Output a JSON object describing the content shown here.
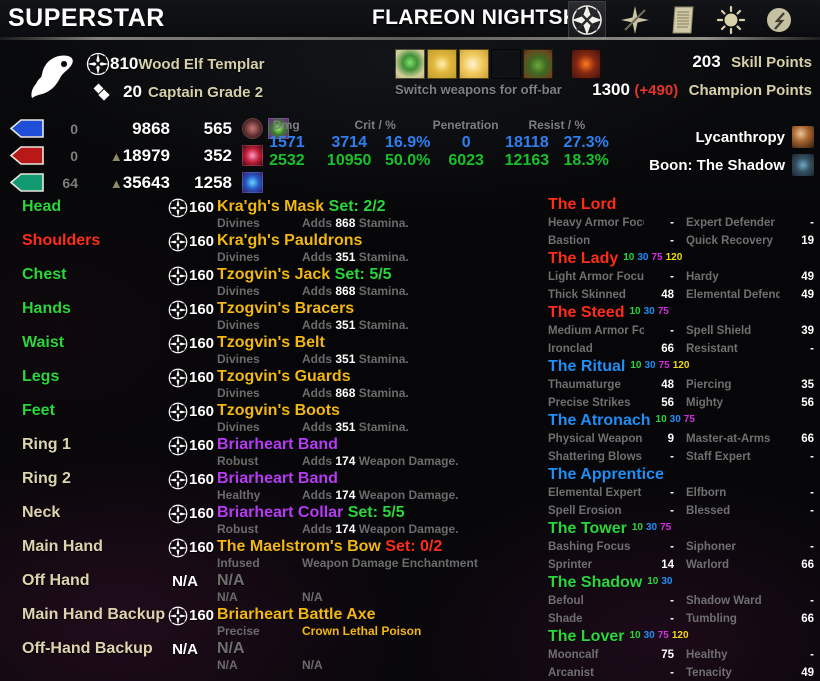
{
  "header": {
    "character_name": "SUPERSTAR",
    "account_name": "FLAREON NIGHTSKY",
    "nav_icons": [
      {
        "name": "inventory-icon",
        "selected": true
      },
      {
        "name": "skills-icon",
        "selected": false
      },
      {
        "name": "journal-icon",
        "selected": false
      },
      {
        "name": "map-icon",
        "selected": false
      },
      {
        "name": "alliance-war-icon",
        "selected": false
      }
    ]
  },
  "hero": {
    "champion_points_level": "810",
    "race_class": "Wood Elf Templar",
    "alliance_rank": "20",
    "alliance_rank_name": "Captain Grade 2",
    "switch_message": "Switch weapons for off-bar",
    "skill_points": "203",
    "skill_points_label": "Skill Points",
    "champion_points": "1300",
    "champion_points_bonus": "(+490)",
    "champion_points_label": "Champion Points"
  },
  "resources": [
    {
      "name": "magicka",
      "color": "#1f4fd8",
      "regen": "0",
      "max": "9868",
      "has_arrow": false,
      "recovery": "565"
    },
    {
      "name": "health",
      "color": "#b81818",
      "regen": "0",
      "max": "18979",
      "has_arrow": true,
      "recovery": "352"
    },
    {
      "name": "stamina",
      "color": "#129a72",
      "regen": "64",
      "max": "35643",
      "has_arrow": true,
      "recovery": "1258"
    }
  ],
  "damage_table": {
    "headers": [
      "Dmg",
      "Crit / %",
      "Penetration",
      "Resist / %"
    ],
    "magicka": {
      "dmg": "1571",
      "crit": "3714",
      "crit_pct": "16.9%",
      "pen": "0",
      "resist": "18118",
      "resist_pct": "27.3%"
    },
    "stamina": {
      "dmg": "2532",
      "crit": "10950",
      "crit_pct": "50.0%",
      "pen": "6023",
      "resist": "12163",
      "resist_pct": "18.3%"
    }
  },
  "statuses": [
    {
      "label": "Lycanthropy",
      "icon": "werewolf-icon"
    },
    {
      "label": "Boon: The Shadow",
      "icon": "mundus-stone-icon"
    }
  ],
  "equipment": [
    {
      "slot": "Head",
      "slot_color": "green",
      "level": "160",
      "item": "Kra'gh's Mask",
      "quality": "gold",
      "set": "Set: 2/2",
      "set_ok": true,
      "trait": "Divines",
      "ench_prefix": "Adds ",
      "ench_amount": "868",
      "ench_suffix": " Stamina."
    },
    {
      "slot": "Shoulders",
      "slot_color": "red",
      "level": "160",
      "item": "Kra'gh's Pauldrons",
      "quality": "gold",
      "set": "",
      "set_ok": true,
      "trait": "Divines",
      "ench_prefix": "Adds ",
      "ench_amount": "351",
      "ench_suffix": " Stamina."
    },
    {
      "slot": "Chest",
      "slot_color": "green",
      "level": "160",
      "item": "Tzogvin's Jack",
      "quality": "gold",
      "set": "Set: 5/5",
      "set_ok": true,
      "trait": "Divines",
      "ench_prefix": "Adds ",
      "ench_amount": "868",
      "ench_suffix": " Stamina."
    },
    {
      "slot": "Hands",
      "slot_color": "green",
      "level": "160",
      "item": "Tzogvin's Bracers",
      "quality": "gold",
      "set": "",
      "set_ok": true,
      "trait": "Divines",
      "ench_prefix": "Adds ",
      "ench_amount": "351",
      "ench_suffix": " Stamina."
    },
    {
      "slot": "Waist",
      "slot_color": "green",
      "level": "160",
      "item": "Tzogvin's Belt",
      "quality": "gold",
      "set": "",
      "set_ok": true,
      "trait": "Divines",
      "ench_prefix": "Adds ",
      "ench_amount": "351",
      "ench_suffix": " Stamina."
    },
    {
      "slot": "Legs",
      "slot_color": "green",
      "level": "160",
      "item": "Tzogvin's Guards",
      "quality": "gold",
      "set": "",
      "set_ok": true,
      "trait": "Divines",
      "ench_prefix": "Adds ",
      "ench_amount": "868",
      "ench_suffix": " Stamina."
    },
    {
      "slot": "Feet",
      "slot_color": "green",
      "level": "160",
      "item": "Tzogvin's Boots",
      "quality": "gold",
      "set": "",
      "set_ok": true,
      "trait": "Divines",
      "ench_prefix": "Adds ",
      "ench_amount": "351",
      "ench_suffix": " Stamina."
    },
    {
      "slot": "Ring 1",
      "slot_color": "tan",
      "level": "160",
      "item": "Briarheart Band",
      "quality": "purple",
      "set": "",
      "set_ok": true,
      "trait": "Robust",
      "ench_prefix": "Adds ",
      "ench_amount": "174",
      "ench_suffix": " Weapon Damage."
    },
    {
      "slot": "Ring 2",
      "slot_color": "tan",
      "level": "160",
      "item": "Briarheart Band",
      "quality": "purple",
      "set": "",
      "set_ok": true,
      "trait": "Healthy",
      "ench_prefix": "Adds ",
      "ench_amount": "174",
      "ench_suffix": " Weapon Damage."
    },
    {
      "slot": "Neck",
      "slot_color": "tan",
      "level": "160",
      "item": "Briarheart Collar",
      "quality": "purple",
      "set": "Set: 5/5",
      "set_ok": true,
      "trait": "Robust",
      "ench_prefix": "Adds ",
      "ench_amount": "174",
      "ench_suffix": " Weapon Damage."
    },
    {
      "slot": "Main Hand",
      "slot_color": "tan",
      "level": "160",
      "item": "The Maelstrom's Bow",
      "quality": "gold",
      "set": "Set: 0/2",
      "set_ok": false,
      "trait": "Infused",
      "ench_prefix": "",
      "ench_amount": "",
      "ench_suffix": "Weapon Damage Enchantment"
    },
    {
      "slot": "Off Hand",
      "slot_color": "tan",
      "level": "N/A",
      "item": "N/A",
      "quality": "na",
      "set": "",
      "set_ok": true,
      "trait": "N/A",
      "ench_prefix": "",
      "ench_amount": "",
      "ench_suffix": "N/A"
    },
    {
      "slot": "Main Hand Backup",
      "slot_color": "tan",
      "level": "160",
      "item": "Briarheart Battle Axe",
      "quality": "gold",
      "set": "",
      "set_ok": true,
      "trait": "Precise",
      "ench_prefix": "",
      "ench_amount": "",
      "ench_suffix": "Crown Lethal Poison",
      "ench_poison": true
    },
    {
      "slot": "Off-Hand Backup",
      "slot_color": "tan",
      "level": "N/A",
      "item": "N/A",
      "quality": "na",
      "set": "",
      "set_ok": true,
      "trait": "N/A",
      "ench_prefix": "",
      "ench_amount": "",
      "ench_suffix": "N/A"
    }
  ],
  "constellations": [
    {
      "name": "The Lord",
      "color": "red",
      "tiers": [],
      "stars": [
        {
          "name": "Heavy Armor Focus",
          "value": "-"
        },
        {
          "name": "Expert Defender",
          "value": "-"
        },
        {
          "name": "Bastion",
          "value": "-"
        },
        {
          "name": "Quick Recovery",
          "value": "19"
        }
      ]
    },
    {
      "name": "The Lady",
      "color": "red",
      "tiers": [
        "10",
        "30",
        "75",
        "120"
      ],
      "stars": [
        {
          "name": "Light Armor Focus",
          "value": "-"
        },
        {
          "name": "Hardy",
          "value": "49"
        },
        {
          "name": "Thick Skinned",
          "value": "48"
        },
        {
          "name": "Elemental Defender",
          "value": "49"
        }
      ]
    },
    {
      "name": "The Steed",
      "color": "red",
      "tiers": [
        "10",
        "30",
        "75"
      ],
      "stars": [
        {
          "name": "Medium Armor Focus",
          "value": "-"
        },
        {
          "name": "Spell Shield",
          "value": "39"
        },
        {
          "name": "Ironclad",
          "value": "66"
        },
        {
          "name": "Resistant",
          "value": "-"
        }
      ]
    },
    {
      "name": "The Ritual",
      "color": "blue",
      "tiers": [
        "10",
        "30",
        "75",
        "120"
      ],
      "stars": [
        {
          "name": "Thaumaturge",
          "value": "48"
        },
        {
          "name": "Piercing",
          "value": "35"
        },
        {
          "name": "Precise Strikes",
          "value": "56"
        },
        {
          "name": "Mighty",
          "value": "56"
        }
      ]
    },
    {
      "name": "The Atronach",
      "color": "blue",
      "tiers": [
        "10",
        "30",
        "75"
      ],
      "stars": [
        {
          "name": "Physical Weapon Expert",
          "value": "9"
        },
        {
          "name": "Master-at-Arms",
          "value": "66"
        },
        {
          "name": "Shattering Blows",
          "value": "-"
        },
        {
          "name": "Staff Expert",
          "value": "-"
        }
      ]
    },
    {
      "name": "The Apprentice",
      "color": "blue",
      "tiers": [],
      "stars": [
        {
          "name": "Elemental Expert",
          "value": "-"
        },
        {
          "name": "Elfborn",
          "value": "-"
        },
        {
          "name": "Spell Erosion",
          "value": "-"
        },
        {
          "name": "Blessed",
          "value": "-"
        }
      ]
    },
    {
      "name": "The Tower",
      "color": "green",
      "tiers": [
        "10",
        "30",
        "75"
      ],
      "stars": [
        {
          "name": "Bashing Focus",
          "value": "-"
        },
        {
          "name": "Siphoner",
          "value": "-"
        },
        {
          "name": "Sprinter",
          "value": "14"
        },
        {
          "name": "Warlord",
          "value": "66"
        }
      ]
    },
    {
      "name": "The Shadow",
      "color": "green",
      "tiers": [
        "10",
        "30"
      ],
      "stars": [
        {
          "name": "Befoul",
          "value": "-"
        },
        {
          "name": "Shadow Ward",
          "value": "-"
        },
        {
          "name": "Shade",
          "value": "-"
        },
        {
          "name": "Tumbling",
          "value": "66"
        }
      ]
    },
    {
      "name": "The Lover",
      "color": "green",
      "tiers": [
        "10",
        "30",
        "75",
        "120"
      ],
      "stars": [
        {
          "name": "Mooncalf",
          "value": "75"
        },
        {
          "name": "Healthy",
          "value": "-"
        },
        {
          "name": "Arcanist",
          "value": "-"
        },
        {
          "name": "Tenacity",
          "value": "49"
        }
      ]
    }
  ],
  "ability_bar": [
    {
      "name": "ability-slot-1"
    },
    {
      "name": "ability-slot-2"
    },
    {
      "name": "ability-slot-3"
    },
    {
      "name": "ability-slot-4"
    },
    {
      "name": "ability-slot-5"
    },
    {
      "name": "ultimate-slot"
    }
  ],
  "colors": {
    "magicka": "#2f7ff0",
    "stamina": "#19c02c",
    "health": "#b81818",
    "gold_quality": "#f2b712",
    "purple_quality": "#b73bf5",
    "set_ok": "#2ad63a",
    "set_bad": "#ff2d18",
    "label_tan": "#d6cfa8"
  }
}
